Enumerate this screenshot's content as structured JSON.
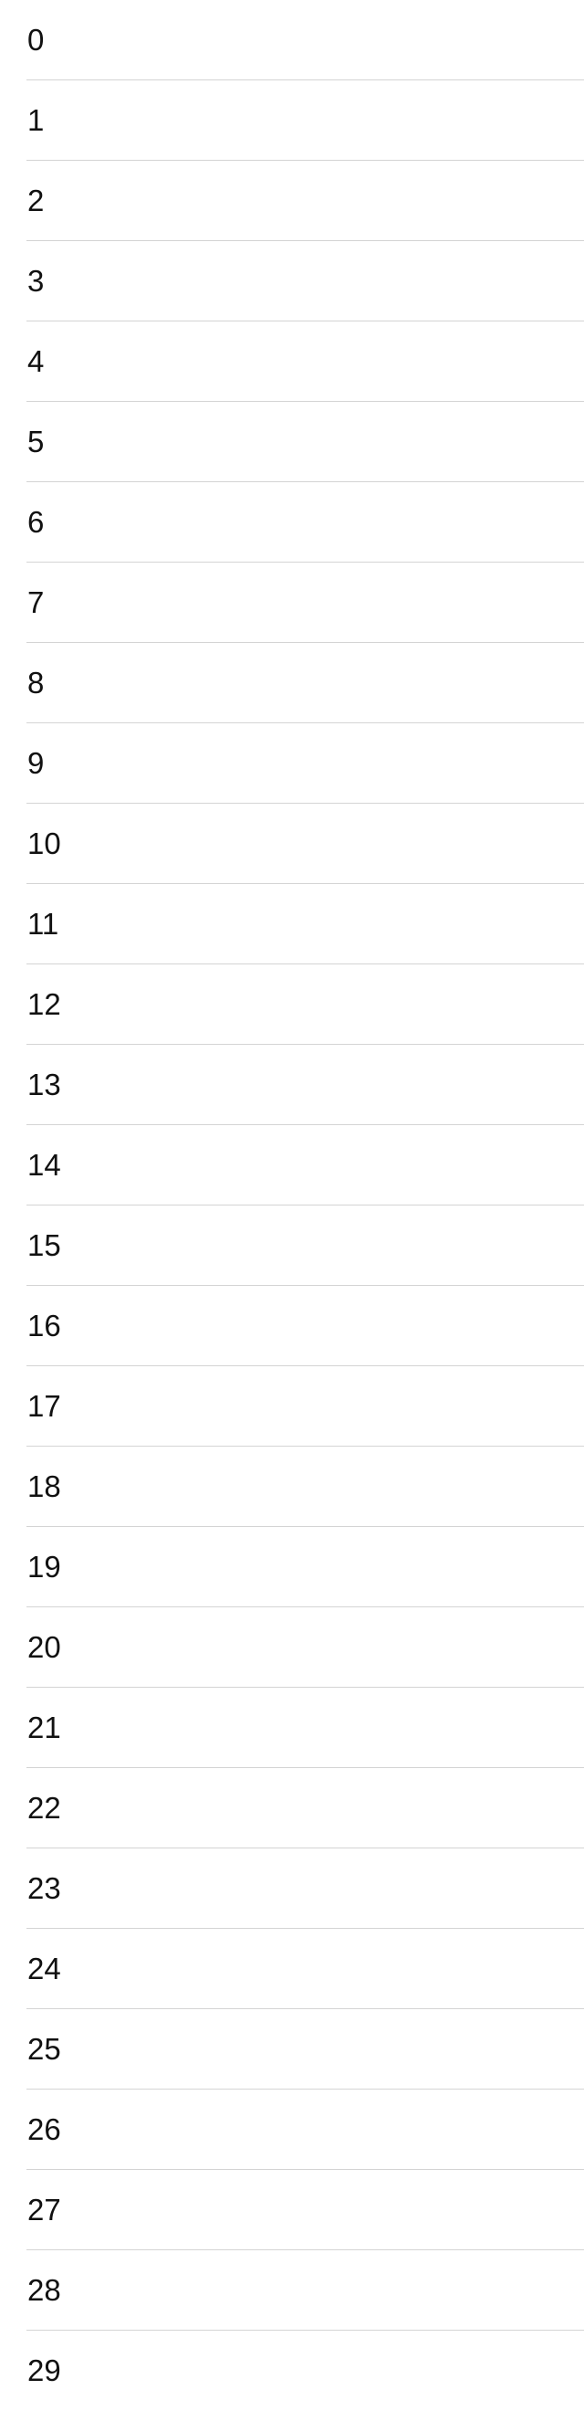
{
  "list": {
    "items": [
      {
        "label": "0"
      },
      {
        "label": "1"
      },
      {
        "label": "2"
      },
      {
        "label": "3"
      },
      {
        "label": "4"
      },
      {
        "label": "5"
      },
      {
        "label": "6"
      },
      {
        "label": "7"
      },
      {
        "label": "8"
      },
      {
        "label": "9"
      },
      {
        "label": "10"
      },
      {
        "label": "11"
      },
      {
        "label": "12"
      },
      {
        "label": "13"
      },
      {
        "label": "14"
      },
      {
        "label": "15"
      },
      {
        "label": "16"
      },
      {
        "label": "17"
      },
      {
        "label": "18"
      },
      {
        "label": "19"
      },
      {
        "label": "20"
      },
      {
        "label": "21"
      },
      {
        "label": "22"
      },
      {
        "label": "23"
      },
      {
        "label": "24"
      },
      {
        "label": "25"
      },
      {
        "label": "26"
      },
      {
        "label": "27"
      },
      {
        "label": "28"
      },
      {
        "label": "29"
      }
    ]
  }
}
